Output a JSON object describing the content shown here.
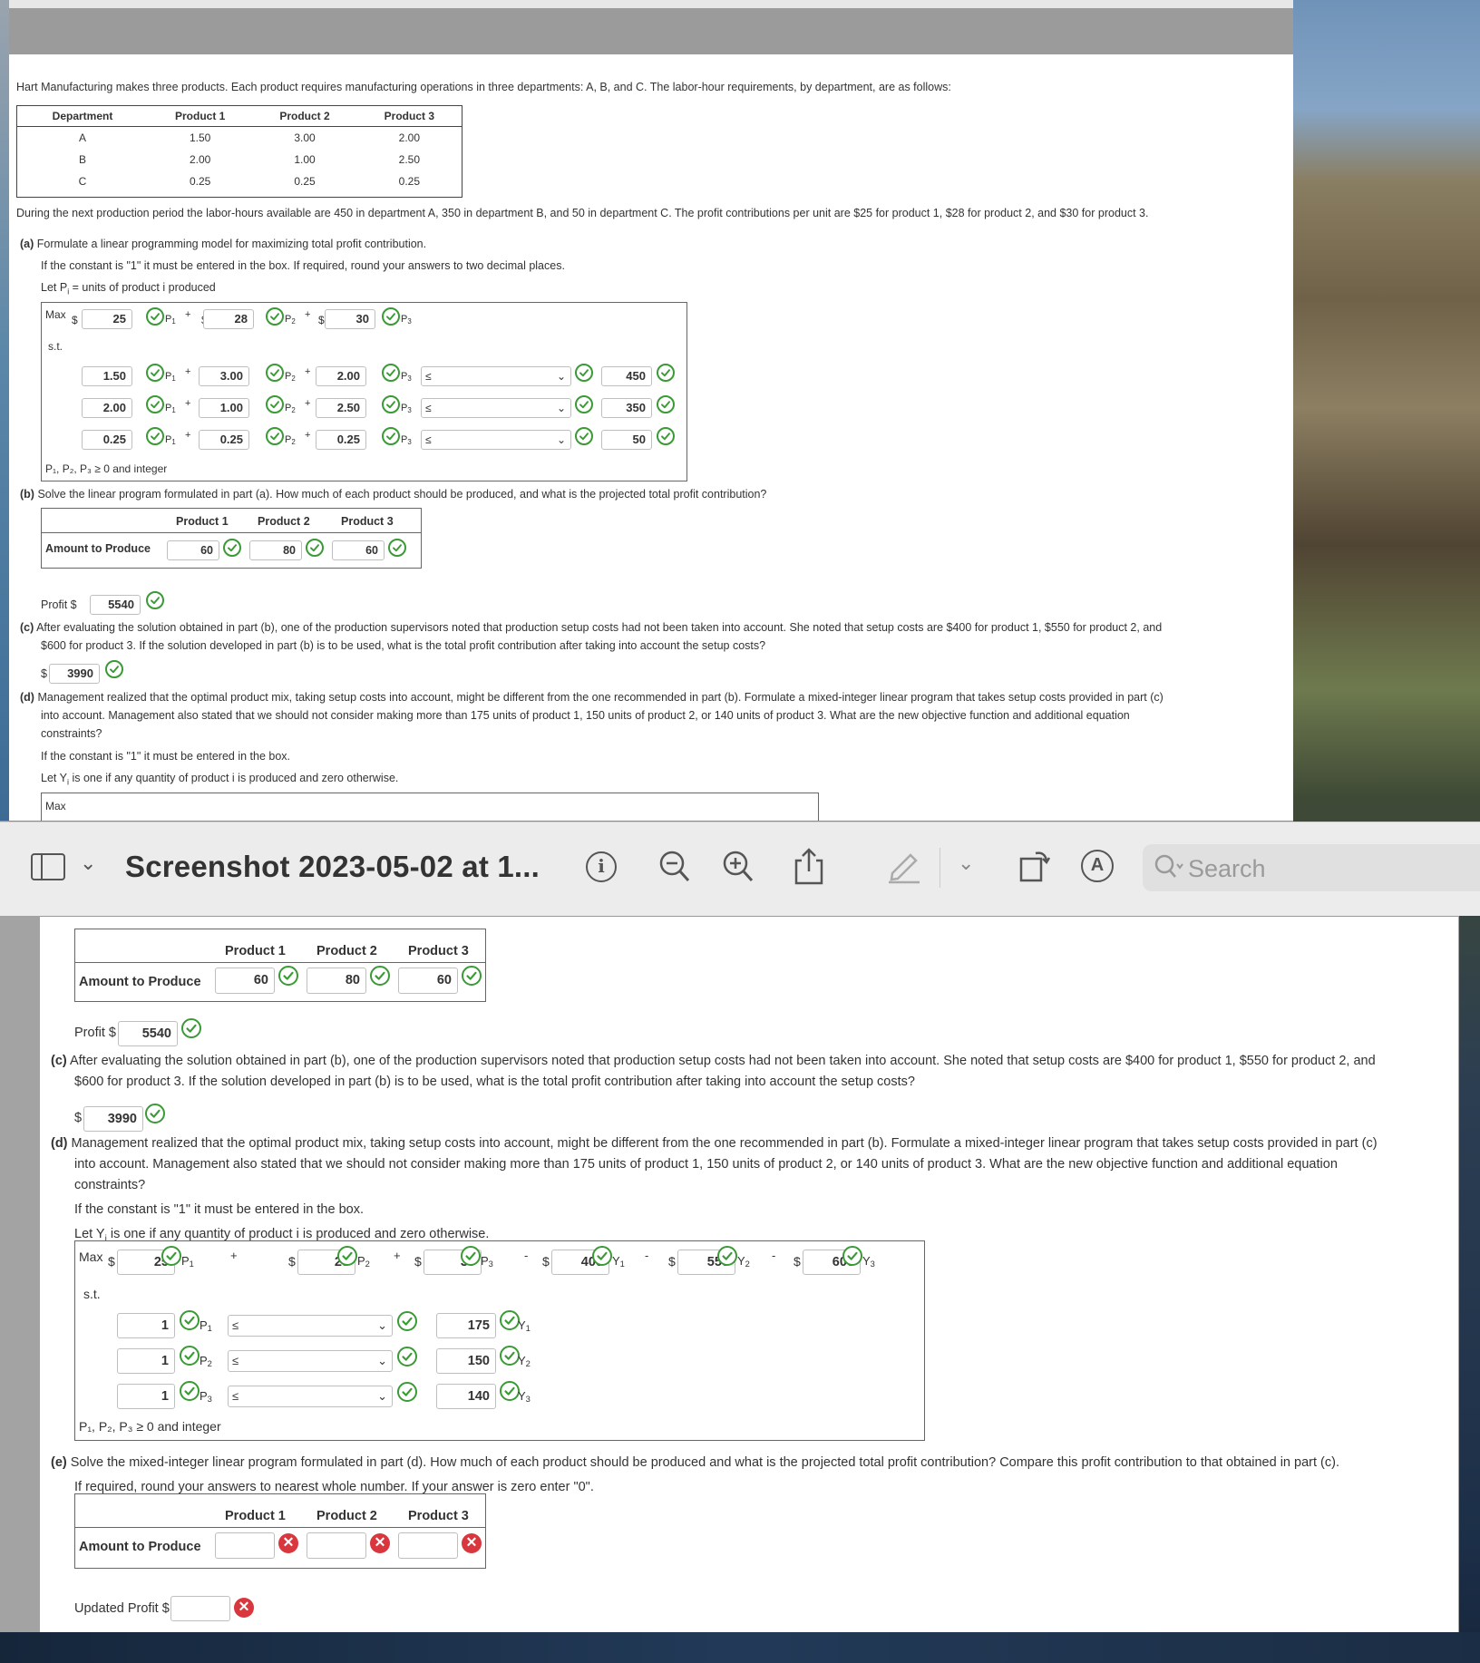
{
  "intro": "Hart Manufacturing makes three products. Each product requires manufacturing operations in three departments: A, B, and C. The labor-hour requirements, by department, are as follows:",
  "dept_table": {
    "headers": [
      "Department",
      "Product 1",
      "Product 2",
      "Product 3"
    ],
    "rows": [
      [
        "A",
        "1.50",
        "3.00",
        "2.00"
      ],
      [
        "B",
        "2.00",
        "1.00",
        "2.50"
      ],
      [
        "C",
        "0.25",
        "0.25",
        "0.25"
      ]
    ]
  },
  "para_period": "During the next production period the labor-hours available are 450 in department A, 350 in department B, and 50 in department C. The profit contributions per unit are $25 for product 1, $28 for product 2, and $30 for product 3.",
  "part_a": {
    "label": "(a)",
    "question": "Formulate a linear programming model for maximizing total profit contribution.",
    "note": "If the constant is \"1\" it must be entered in the box. If required, round your answers to two decimal places.",
    "let": "Let P",
    "let_sub": "i",
    "let_rest": " = units of product i produced",
    "max_label": "Max",
    "st_label": "s.t.",
    "dollar": "$",
    "plus": "+",
    "obj": [
      "25",
      "28",
      "30"
    ],
    "vars": [
      "P",
      "P",
      "P"
    ],
    "subs": [
      "1",
      "2",
      "3"
    ],
    "constraints": [
      {
        "coefs": [
          "1.50",
          "3.00",
          "2.00"
        ],
        "sign": "≤",
        "rhs": "450"
      },
      {
        "coefs": [
          "2.00",
          "1.00",
          "2.50"
        ],
        "sign": "≤",
        "rhs": "350"
      },
      {
        "coefs": [
          "0.25",
          "0.25",
          "0.25"
        ],
        "sign": "≤",
        "rhs": "50"
      }
    ],
    "nonneg": "P₁, P₂, P₃ ≥ 0 and integer"
  },
  "part_b": {
    "label": "(b)",
    "question": "Solve the linear program formulated in part (a). How much of each product should be produced, and what is the projected total profit contribution?",
    "headers": [
      "Product 1",
      "Product 2",
      "Product 3"
    ],
    "row_label": "Amount to Produce",
    "values": [
      "60",
      "80",
      "60"
    ],
    "profit_label": "Profit $",
    "profit": "5540"
  },
  "part_c": {
    "label": "(c)",
    "line1": "After evaluating the solution obtained in part (b), one of the production supervisors noted that production setup costs had not been taken into account. She noted that setup costs are $400 for product 1, $550 for product 2, and",
    "line2": "$600 for product 3. If the solution developed in part (b) is to be used, what is the total profit contribution after taking into account the setup costs?",
    "dollar": "$",
    "value": "3990"
  },
  "part_d": {
    "label": "(d)",
    "line1": "Management realized that the optimal product mix, taking setup costs into account, might be different from the one recommended in part (b). Formulate a mixed-integer linear program that takes setup costs provided in part (c)",
    "line2": "into account. Management also stated that we should not consider making more than 175 units of product 1, 150 units of product 2, or 140 units of product 3. What are the new objective function and additional equation",
    "line3": "constraints?",
    "note": "If the constant is \"1\" it must be entered in the box.",
    "let": "Let Y",
    "let_sub": "i",
    "let_rest": " is one if any quantity of product i is produced and zero otherwise.",
    "max_label": "Max",
    "st_label": "s.t.",
    "obj": [
      "25",
      "28",
      "30",
      "400",
      "550",
      "600"
    ],
    "obj_vars": [
      "P",
      "P",
      "P",
      "Y",
      "Y",
      "Y"
    ],
    "obj_subs": [
      "1",
      "2",
      "3",
      "1",
      "2",
      "3"
    ],
    "ops": [
      "+",
      "+",
      "-",
      "-",
      "-"
    ],
    "constraints": [
      {
        "coef": "1",
        "var": "P",
        "sub": "1",
        "sign": "≤",
        "rhs": "175",
        "rvar": "Y",
        "rsub": "1"
      },
      {
        "coef": "1",
        "var": "P",
        "sub": "2",
        "sign": "≤",
        "rhs": "150",
        "rvar": "Y",
        "rsub": "2"
      },
      {
        "coef": "1",
        "var": "P",
        "sub": "3",
        "sign": "≤",
        "rhs": "140",
        "rvar": "Y",
        "rsub": "3"
      }
    ],
    "nonneg": "P₁, P₂, P₃ ≥ 0 and integer"
  },
  "part_e": {
    "label": "(e)",
    "line1": "Solve the mixed-integer linear program formulated in part (d). How much of each product should be produced and what is the projected total profit contribution? Compare this profit contribution to that obtained in part (c).",
    "line2": "If required, round your answers to nearest whole number. If your answer is zero enter \"0\".",
    "headers": [
      "Product 1",
      "Product 2",
      "Product 3"
    ],
    "row_label": "Amount to Produce",
    "values": [
      "",
      "",
      ""
    ],
    "profit_label": "Updated Profit $",
    "profit": ""
  },
  "preview_toolbar": {
    "title": "Screenshot 2023-05-02 at 1...",
    "search_placeholder": "Search",
    "icons": [
      "sidebar-icon",
      "chevron-down-icon",
      "info-icon",
      "zoom-out-icon",
      "zoom-in-icon",
      "share-icon",
      "markup-pen-icon",
      "rotate-icon",
      "annotate-icon",
      "search-icon"
    ]
  },
  "colors": {
    "check": "#3a9a35",
    "error": "#d9363e",
    "toolbar": "#ececec",
    "header_gray": "#9b9b9b"
  }
}
